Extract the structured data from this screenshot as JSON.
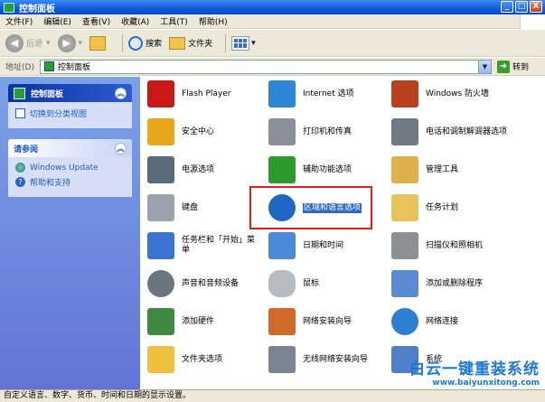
{
  "window": {
    "title": "控制面板",
    "buttons": {
      "minimize": "_",
      "maximize": "□",
      "close": "X"
    }
  },
  "menubar": [
    "文件(F)",
    "编辑(E)",
    "查看(V)",
    "收藏(A)",
    "工具(T)",
    "帮助(H)"
  ],
  "toolbar": {
    "back_label": "后退",
    "search_label": "搜索",
    "folders_label": "文件夹"
  },
  "addressbar": {
    "label": "地址(D)",
    "value": "控制面板",
    "go_label": "转到"
  },
  "leftpane": {
    "main_panel": {
      "title": "控制面板",
      "links": [
        "切换到分类视图"
      ]
    },
    "see_also": {
      "title": "请参阅",
      "links": [
        "Windows Update",
        "帮助和支持"
      ]
    }
  },
  "items": [
    {
      "label": "Flash Player",
      "icon": "flash-player-icon",
      "color": "#c81818"
    },
    {
      "label": "Internet 选项",
      "icon": "internet-options-icon",
      "color": "#2e86d6"
    },
    {
      "label": "Windows 防火墙",
      "icon": "firewall-icon",
      "color": "#b8401e"
    },
    {
      "label": "安全中心",
      "icon": "security-center-icon",
      "color": "#e8a81a"
    },
    {
      "label": "打印机和传真",
      "icon": "printer-icon",
      "color": "#8a8f99"
    },
    {
      "label": "电话和调制解调器选项",
      "icon": "phone-modem-icon",
      "color": "#707a85"
    },
    {
      "label": "电源选项",
      "icon": "power-options-icon",
      "color": "#5a6b7c"
    },
    {
      "label": "辅助功能选项",
      "icon": "accessibility-icon",
      "color": "#2c9a2c"
    },
    {
      "label": "管理工具",
      "icon": "admin-tools-icon",
      "color": "#e0b04a"
    },
    {
      "label": "键盘",
      "icon": "keyboard-icon",
      "color": "#9aa3ad"
    },
    {
      "label": "区域和语言选项",
      "icon": "region-language-icon",
      "color": "#1f67c2"
    },
    {
      "label": "任务计划",
      "icon": "scheduled-tasks-icon",
      "color": "#e8c25a"
    },
    {
      "label": "任务栏和「开始」菜单",
      "icon": "taskbar-icon",
      "color": "#3b74d4"
    },
    {
      "label": "日期和时间",
      "icon": "date-time-icon",
      "color": "#4a8ad8"
    },
    {
      "label": "扫描仪和照相机",
      "icon": "scanner-camera-icon",
      "color": "#8c8f94"
    },
    {
      "label": "声音和音频设备",
      "icon": "sound-icon",
      "color": "#6c747d"
    },
    {
      "label": "鼠标",
      "icon": "mouse-icon",
      "color": "#b6bcc4"
    },
    {
      "label": "添加或删除程序",
      "icon": "add-remove-programs-icon",
      "color": "#5b8bd2"
    },
    {
      "label": "添加硬件",
      "icon": "add-hardware-icon",
      "color": "#3e8a3e"
    },
    {
      "label": "网络安装向导",
      "icon": "network-setup-icon",
      "color": "#d06a2a"
    },
    {
      "label": "网络连接",
      "icon": "network-connections-icon",
      "color": "#2e7fd0"
    },
    {
      "label": "文件夹选项",
      "icon": "folder-options-icon",
      "color": "#f0c040"
    },
    {
      "label": "无线网络安装向导",
      "icon": "wireless-setup-icon",
      "color": "#7a8591"
    },
    {
      "label": "系统",
      "icon": "system-icon",
      "color": "#4f7fc9"
    }
  ],
  "statusbar": {
    "text": "自定义语言、数字、货币、时间和日期的显示设置。"
  },
  "watermark": {
    "title": "白云一键重装系统",
    "url": "www.baiyunxitong.com"
  }
}
